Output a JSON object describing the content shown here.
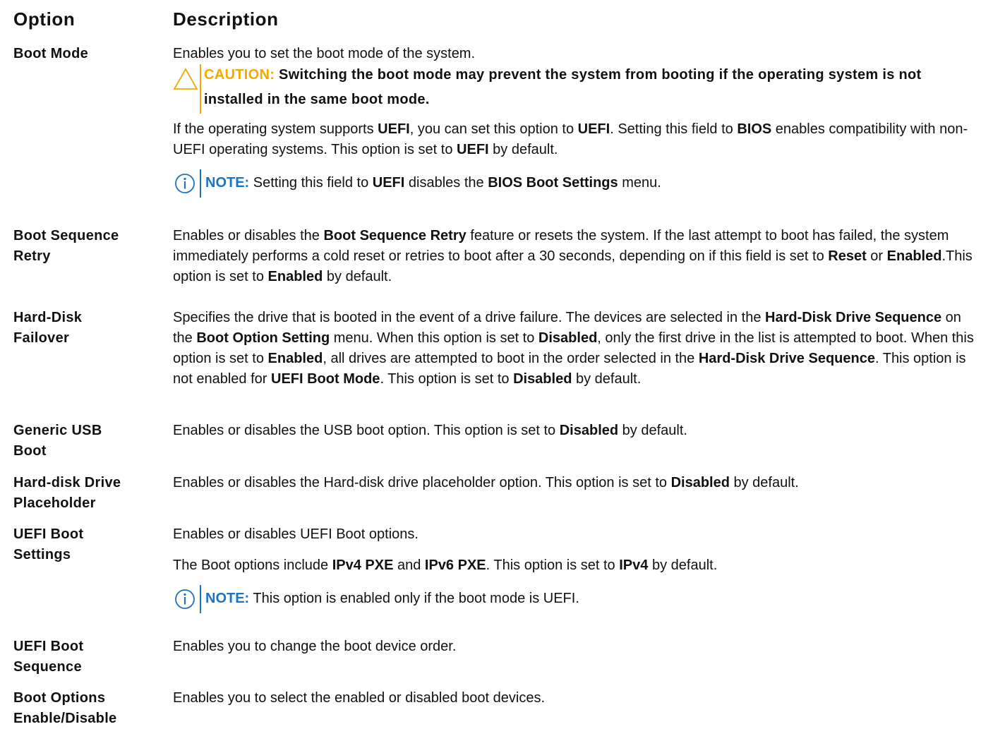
{
  "header": {
    "option": "Option",
    "description": "Description"
  },
  "rows": {
    "boot_mode": {
      "option": "Boot Mode",
      "line1": "Enables you to set the boot mode of the system.",
      "caution_label": "CAUTION:",
      "caution_text": "Switching the boot mode may prevent the system from booting if the operating system is not installed in the same boot mode.",
      "para_a": "If the operating system supports ",
      "para_b": "UEFI",
      "para_c": ", you can set this option to ",
      "para_d": "UEFI",
      "para_e": ". Setting this field to ",
      "para_f": "BIOS",
      "para_g": " enables compatibility with non-UEFI operating systems. This option is set to ",
      "para_h": "UEFI",
      "para_i": " by default.",
      "note_label": "NOTE:",
      "note_a": " Setting this field to ",
      "note_b": "UEFI",
      "note_c": " disables the ",
      "note_d": "BIOS Boot Settings",
      "note_e": " menu."
    },
    "boot_sequence_retry": {
      "option": "Boot Sequence Retry",
      "t1": "Enables or disables the ",
      "t2": "Boot Sequence Retry",
      "t3": " feature or resets the system. If the last attempt to boot has failed, the system immediately performs a cold reset or retries to boot after a 30 seconds, depending on if this field is set to ",
      "t4": "Reset",
      "t5": " or ",
      "t6": "Enabled",
      "t7": ".This option is set to ",
      "t8": "Enabled",
      "t9": " by default."
    },
    "hard_disk_failover": {
      "option": "Hard-Disk Failover",
      "t1": "Specifies the drive that is booted in the event of a drive failure. The devices are selected in the ",
      "t2": "Hard-Disk Drive Sequence",
      "t3": " on the ",
      "t4": "Boot Option Setting",
      "t5": " menu. When this option is set to ",
      "t6": "Disabled",
      "t7": ", only the first drive in the list is attempted to boot. When this option is set to ",
      "t8": "Enabled",
      "t9": ", all drives are attempted to boot in the order selected in the ",
      "t10": "Hard-Disk Drive Sequence",
      "t11": ". This option is not enabled for ",
      "t12": "UEFI Boot Mode",
      "t13": ". This option is set to ",
      "t14": "Disabled",
      "t15": " by default."
    },
    "generic_usb_boot": {
      "option": "Generic USB Boot",
      "t1": "Enables or disables the USB boot option. This option is set to ",
      "t2": "Disabled",
      "t3": " by default."
    },
    "hard_disk_drive_placeholder": {
      "option": "Hard-disk Drive Placeholder",
      "t1": "Enables or disables the Hard-disk drive placeholder option. This option is set to ",
      "t2": "Disabled",
      "t3": " by default."
    },
    "uefi_boot_settings": {
      "option": "UEFI Boot Settings",
      "line1": "Enables or disables UEFI Boot options.",
      "t1": "The Boot options include ",
      "t2": "IPv4 PXE",
      "t3": " and ",
      "t4": "IPv6 PXE",
      "t5": ". This option is set to ",
      "t6": "IPv4",
      "t7": " by default.",
      "note_label": "NOTE:",
      "note_text": " This option is enabled only if the boot mode is UEFI."
    },
    "uefi_boot_sequence": {
      "option": "UEFI Boot Sequence",
      "t1": "Enables you to change the boot device order."
    },
    "boot_options_enable_disable": {
      "option": "Boot Options Enable/Disable",
      "t1": "Enables you to select the enabled or disabled boot devices."
    }
  },
  "colors": {
    "caution": "#f2a900",
    "note": "#1a73c6",
    "text": "#111111"
  },
  "icons": {
    "caution": "warning-triangle-icon",
    "note": "info-circle-icon"
  }
}
